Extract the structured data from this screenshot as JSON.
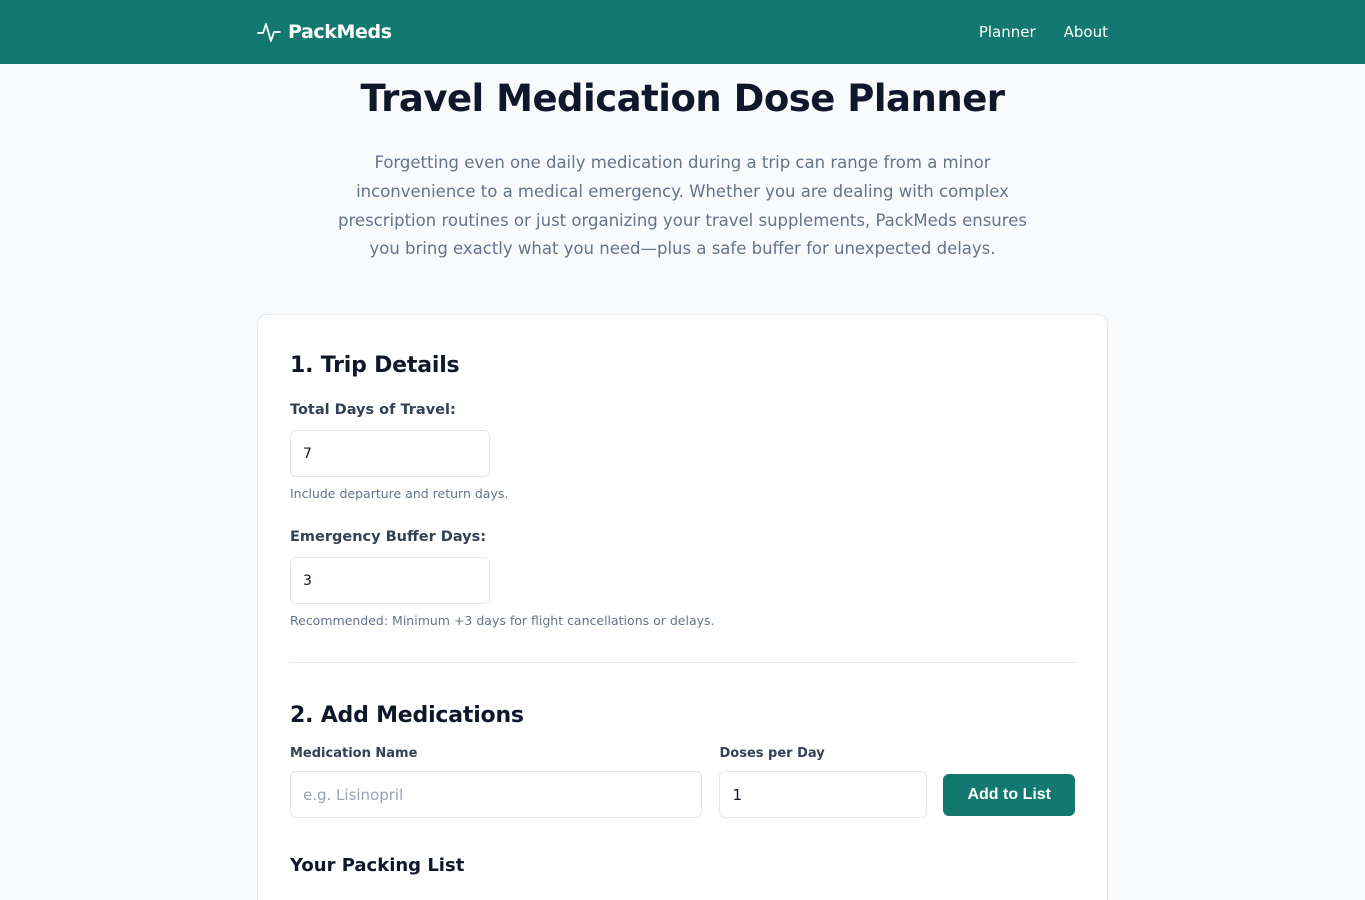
{
  "header": {
    "brand": "PackMeds",
    "logo_icon": "pulse-icon",
    "nav": [
      "Planner",
      "About"
    ]
  },
  "hero": {
    "title": "Travel Medication Dose Planner",
    "intro": "Forgetting even one daily medication during a trip can range from a minor inconvenience to a medical emergency. Whether you are dealing with complex prescription routines or just organizing your travel supplements, PackMeds ensures you bring exactly what you need—plus a safe buffer for unexpected delays."
  },
  "trip": {
    "heading": "1. Trip Details",
    "days_label": "Total Days of Travel:",
    "days_value": "7",
    "days_hint": "Include departure and return days.",
    "buffer_label": "Emergency Buffer Days:",
    "buffer_value": "3",
    "buffer_hint": "Recommended: Minimum +3 days for flight cancellations or delays."
  },
  "meds": {
    "heading": "2. Add Medications",
    "name_label": "Medication Name",
    "name_placeholder": "e.g. Lisinopril",
    "doses_label": "Doses per Day",
    "doses_value": "1",
    "add_button": "Add to List"
  },
  "packing": {
    "heading": "Your Packing List"
  },
  "colors": {
    "brand": "#13786f",
    "background": "#f8fafc",
    "text": "#0f172a",
    "muted": "#64748b"
  }
}
